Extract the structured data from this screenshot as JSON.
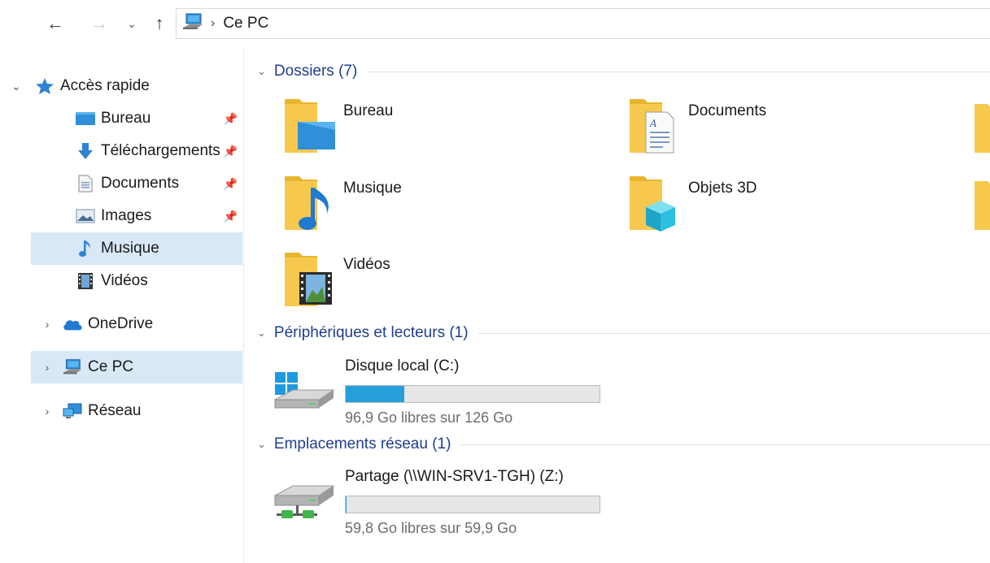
{
  "address": {
    "crumb": "Ce PC"
  },
  "nav": {
    "quick_access": "Accès rapide",
    "items": [
      {
        "label": "Bureau",
        "pinned": true
      },
      {
        "label": "Téléchargements",
        "pinned": true
      },
      {
        "label": "Documents",
        "pinned": true
      },
      {
        "label": "Images",
        "pinned": true
      },
      {
        "label": "Musique",
        "pinned": false
      },
      {
        "label": "Vidéos",
        "pinned": false
      }
    ],
    "onedrive": "OneDrive",
    "this_pc": "Ce PC",
    "network": "Réseau"
  },
  "content": {
    "folders_header": "Dossiers (7)",
    "folders": [
      {
        "name": "Bureau",
        "icon": "desktop-folder-icon"
      },
      {
        "name": "Documents",
        "icon": "documents-folder-icon"
      },
      {
        "name": "Musique",
        "icon": "music-folder-icon"
      },
      {
        "name": "Objets 3D",
        "icon": "3d-objects-folder-icon"
      },
      {
        "name": "Vidéos",
        "icon": "videos-folder-icon"
      }
    ],
    "devices_header": "Périphériques et lecteurs (1)",
    "drive": {
      "name": "Disque local (C:)",
      "free": "96,9 Go libres sur 126 Go",
      "used_fraction": 0.231
    },
    "network_header": "Emplacements réseau (1)",
    "share": {
      "name": "Partage (\\\\WIN-SRV1-TGH) (Z:)",
      "free": "59,8 Go libres sur 59,9 Go",
      "used_fraction": 0.0017
    }
  },
  "colors": {
    "accent": "#26a0da",
    "header_blue": "#1e3e8c",
    "selection": "#d8e8f7",
    "folder": "#f6c94e"
  }
}
